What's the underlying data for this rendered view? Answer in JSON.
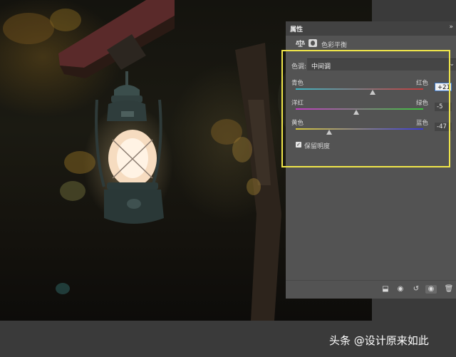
{
  "panel": {
    "tab_title": "属性",
    "collapse_icon": "double-chevron-right-icon",
    "adjustment_title": "色彩平衡",
    "tone": {
      "label": "色调:",
      "value": "中间调"
    },
    "rows": [
      {
        "left": "青色",
        "right": "红色",
        "value": "+21",
        "fraction": 0.605,
        "colors": [
          "#3fb7c4",
          "#c43c3c"
        ]
      },
      {
        "left": "洋红",
        "right": "绿色",
        "value": "-5",
        "fraction": 0.475,
        "colors": [
          "#c43cc4",
          "#3cc43c"
        ]
      },
      {
        "left": "黄色",
        "right": "蓝色",
        "value": "-47",
        "fraction": 0.265,
        "colors": [
          "#d6c73c",
          "#3c3cd6"
        ]
      }
    ],
    "preserve_luminosity": {
      "label": "保留明度",
      "checked": true
    },
    "footer_icons": [
      "clip-to-layer-icon",
      "view-previous-state-icon",
      "reset-icon",
      "visibility-eye-icon",
      "trash-icon"
    ]
  },
  "highlight_color": "#f0e64a",
  "watermark": "头条 @设计原来如此"
}
